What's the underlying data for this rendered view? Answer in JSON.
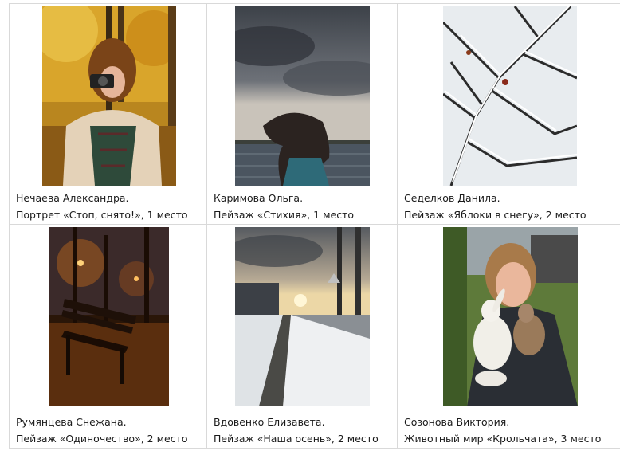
{
  "gallery": {
    "items": [
      {
        "author": "Нечаева Александра.",
        "work": "Портрет «Стоп, снято!», 1 место",
        "photo_icon": "autumn-portrait-photo"
      },
      {
        "author": "Каримова Ольга.",
        "work": "Пейзаж «Стихия», 1 место",
        "photo_icon": "storm-lake-photo"
      },
      {
        "author": "Седелков Данила.",
        "work": "Пейзаж «Яблоки в снегу», 2 место",
        "photo_icon": "snowy-branches-photo"
      },
      {
        "author": "Румянцева Снежана.",
        "work": "Пейзаж «Одиночество», 2 место",
        "photo_icon": "night-bench-photo"
      },
      {
        "author": "Вдовенко Елизавета.",
        "work": "Пейзаж «Наша осень», 2 место",
        "photo_icon": "sunset-road-photo"
      },
      {
        "author": "Созонова Виктория.",
        "work": "Животный мир «Крольчата», 3 место",
        "photo_icon": "girl-rabbits-photo"
      }
    ]
  }
}
